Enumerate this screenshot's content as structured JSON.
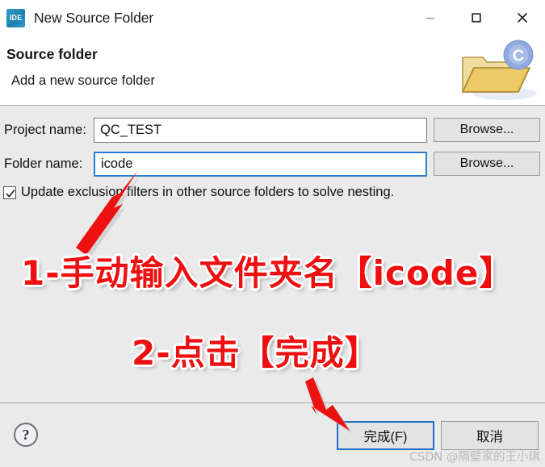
{
  "window": {
    "app_icon_label": "IDE",
    "title": "New Source Folder",
    "controls": {
      "minimize": "minimize-icon",
      "maximize": "maximize-icon",
      "close": "close-icon"
    }
  },
  "header": {
    "title": "Source folder",
    "subtitle": "Add a new source folder",
    "graphic": "folder-with-c-badge-icon",
    "badge_letter": "C"
  },
  "form": {
    "project": {
      "label": "Project name:",
      "value": "QC_TEST",
      "placeholder": "",
      "browse_label": "Browse...",
      "focused": false
    },
    "folder": {
      "label": "Folder name:",
      "value": "icode",
      "placeholder": "",
      "browse_label": "Browse...",
      "focused": true
    },
    "checkbox": {
      "label": "Update exclusion filters in other source folders to solve nesting.",
      "checked": true
    }
  },
  "footer": {
    "help_label": "?",
    "finish_label": "完成(F)",
    "cancel_label": "取消"
  },
  "annotations": {
    "step1": "1-手动输入文件夹名【icode】",
    "step2": "2-点击【完成】",
    "arrow_color": "#ee1111"
  },
  "watermark": "CSDN @隔壁家的王小琪",
  "colors": {
    "accent_blue": "#2a7fc9",
    "default_button_border": "#1f6fc4",
    "body_background": "#eaeaea",
    "title_background": "#ffffff",
    "annotation_red": "#ee1010",
    "folder_yellow": "#e9c96a",
    "badge_blue": "#7d9ed8"
  }
}
